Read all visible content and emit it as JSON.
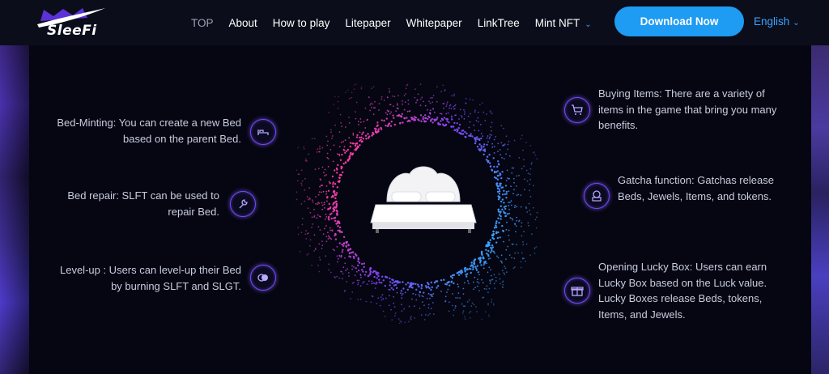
{
  "brand": {
    "name": "SleeFi"
  },
  "nav": {
    "items": [
      "TOP",
      "About",
      "How to play",
      "Litepaper",
      "Whitepaper",
      "LinkTree",
      "Mint NFT"
    ],
    "download_label": "Download Now",
    "language": "English"
  },
  "features": {
    "left": [
      {
        "icon": "bed-icon",
        "text": "Bed-Minting: You can create a new Bed based on the parent Bed."
      },
      {
        "icon": "wrench-icon",
        "text": "Bed repair: SLFT can be used to repair Bed."
      },
      {
        "icon": "level-up-icon",
        "text": "Level-up : Users can level-up their Bed  by burning SLFT and SLGT."
      }
    ],
    "right": [
      {
        "icon": "cart-icon",
        "text": "Buying Items: There are a variety of items in the game that bring you many benefits."
      },
      {
        "icon": "gacha-icon",
        "text": "Gatcha function: Gatchas release Beds, Jewels, Items, and tokens."
      },
      {
        "icon": "gift-icon",
        "text": "Opening Lucky Box: Users can earn Lucky Box based on the Luck value. Lucky Boxes release Beds, tokens, Items, and Jewels."
      }
    ]
  },
  "colors": {
    "accent": "#1e9bf2",
    "ring_pink": "#ff3ea5",
    "ring_blue": "#3aa3ff",
    "ring_purple": "#7b3dff"
  }
}
